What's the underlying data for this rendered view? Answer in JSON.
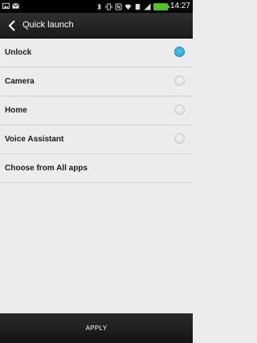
{
  "status_bar": {
    "time": "14:27",
    "battery_level": "",
    "left_icons": [
      "image-icon",
      "gmail-icon"
    ],
    "right_icons": [
      "bluetooth-icon",
      "vibrate-icon",
      "nfc-icon",
      "wifi-icon",
      "sd-icon",
      "signal-icon",
      "battery-icon"
    ],
    "battery_color": "#53c22b"
  },
  "action_bar": {
    "title": "Quick launch",
    "back_icon": "chevron-left-icon"
  },
  "options": [
    {
      "label": "Unlock",
      "selected": true
    },
    {
      "label": "Camera",
      "selected": false
    },
    {
      "label": "Home",
      "selected": false
    },
    {
      "label": "Voice Assistant",
      "selected": false
    },
    {
      "label": "Choose from All apps",
      "selected": false
    }
  ],
  "bottom_bar": {
    "apply_label": "APPLY"
  },
  "colors": {
    "accent": "#2fa9df",
    "background": "#ececec",
    "bar": "#1b1b1b"
  }
}
